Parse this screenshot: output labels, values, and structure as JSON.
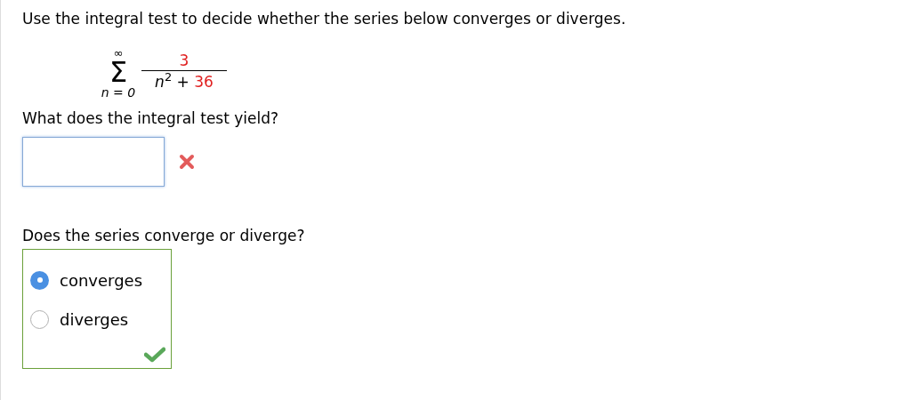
{
  "prompt": "Use the integral test to decide whether the series below converges or diverges.",
  "series": {
    "symbol": "Σ",
    "upper": "∞",
    "lower": "n = 0",
    "numerator": "3",
    "denominator": {
      "variable": "n",
      "exponent": "2",
      "operator": "+",
      "constant": "36"
    }
  },
  "question_1": {
    "text": "What does the integral test yield?",
    "answer": {
      "correct": false
    }
  },
  "question_2": {
    "text": "Does the series converge or diverge?",
    "correct": true,
    "options": [
      {
        "label": "converges",
        "selected": true
      },
      {
        "label": "diverges",
        "selected": false
      }
    ]
  }
}
